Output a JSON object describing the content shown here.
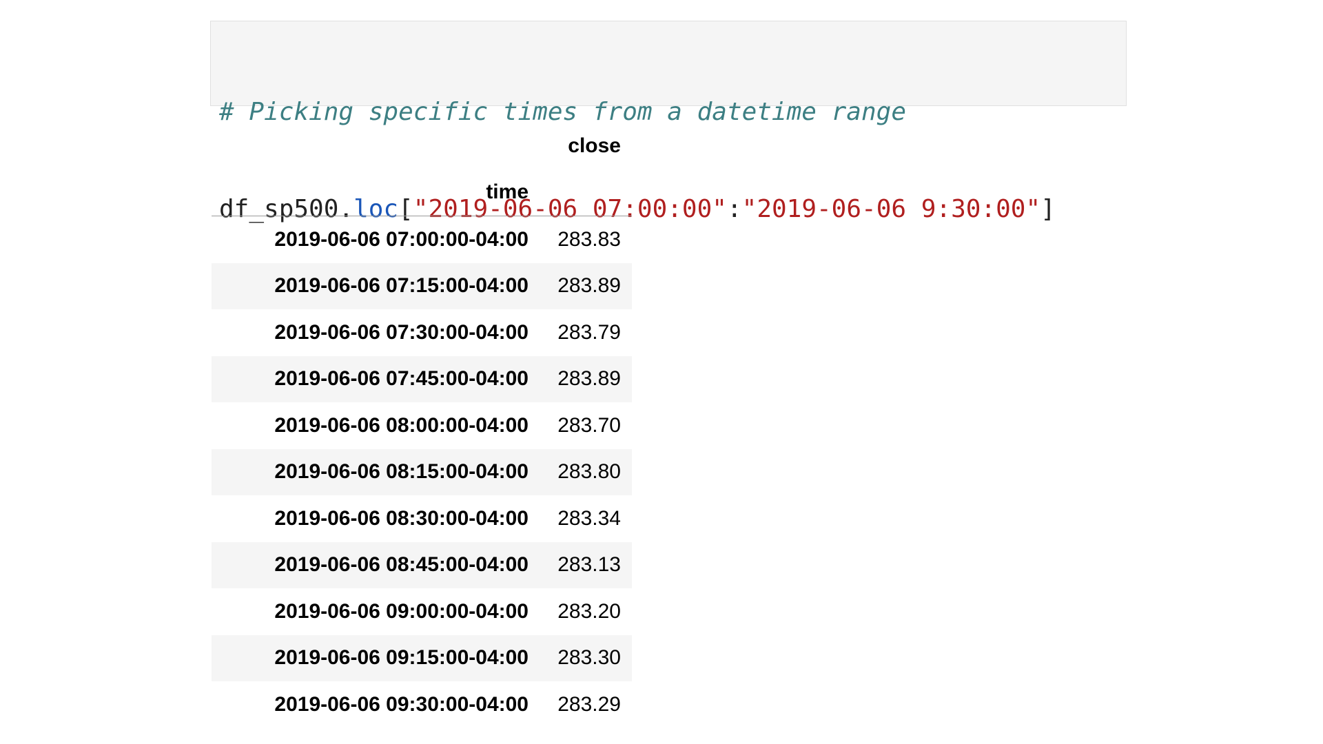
{
  "code": {
    "comment": "# Picking specific times from a datetime range",
    "var": "df_sp500",
    "dot": ".",
    "attr": "loc",
    "open": "[",
    "start": "\"2019-06-06 07:00:00\"",
    "colon": ":",
    "end": "\"2019-06-06 9:30:00\"",
    "close": "]"
  },
  "table": {
    "column_header": "close",
    "index_header": "time",
    "rows": [
      {
        "time": "2019-06-06 07:00:00-04:00",
        "close": "283.83"
      },
      {
        "time": "2019-06-06 07:15:00-04:00",
        "close": "283.89"
      },
      {
        "time": "2019-06-06 07:30:00-04:00",
        "close": "283.79"
      },
      {
        "time": "2019-06-06 07:45:00-04:00",
        "close": "283.89"
      },
      {
        "time": "2019-06-06 08:00:00-04:00",
        "close": "283.70"
      },
      {
        "time": "2019-06-06 08:15:00-04:00",
        "close": "283.80"
      },
      {
        "time": "2019-06-06 08:30:00-04:00",
        "close": "283.34"
      },
      {
        "time": "2019-06-06 08:45:00-04:00",
        "close": "283.13"
      },
      {
        "time": "2019-06-06 09:00:00-04:00",
        "close": "283.20"
      },
      {
        "time": "2019-06-06 09:15:00-04:00",
        "close": "283.30"
      },
      {
        "time": "2019-06-06 09:30:00-04:00",
        "close": "283.29"
      }
    ]
  }
}
